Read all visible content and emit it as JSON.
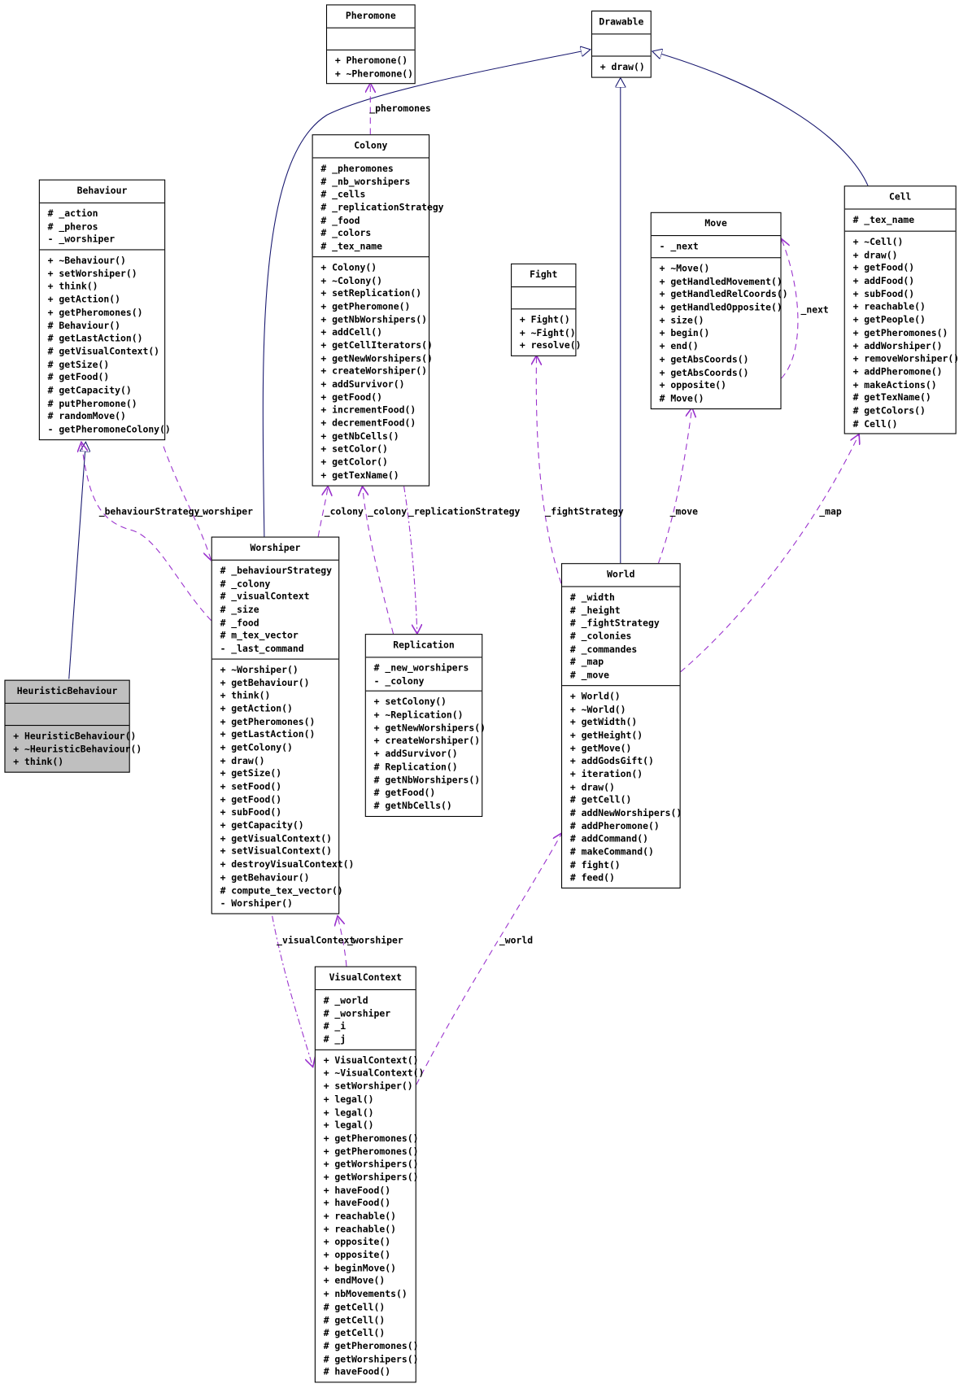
{
  "colors": {
    "inheritance": "#191970",
    "association": "#9a32cd",
    "box_border": "#000000",
    "highlight_box": "#bfbfbf"
  },
  "classes": {
    "pheromone": {
      "name": "Pheromone",
      "attributes": [],
      "operations": [
        "+ Pheromone()",
        "+ ~Pheromone()"
      ]
    },
    "drawable": {
      "name": "Drawable",
      "attributes": [],
      "operations": [
        "+ draw()"
      ]
    },
    "behaviour": {
      "name": "Behaviour",
      "attributes": [
        "# _action",
        "# _pheros",
        "- _worshiper"
      ],
      "operations": [
        "+ ~Behaviour()",
        "+ setWorshiper()",
        "+ think()",
        "+ getAction()",
        "+ getPheromones()",
        "# Behaviour()",
        "# getLastAction()",
        "# getVisualContext()",
        "# getSize()",
        "# getFood()",
        "# getCapacity()",
        "# putPheromone()",
        "# randomMove()",
        "- getPheromoneColony()"
      ]
    },
    "colony": {
      "name": "Colony",
      "attributes": [
        "# _pheromones",
        "# _nb_worshipers",
        "# _cells",
        "# _replicationStrategy",
        "# _food",
        "# _colors",
        "# _tex_name"
      ],
      "operations": [
        "+ Colony()",
        "+ ~Colony()",
        "+ setReplication()",
        "+ getPheromone()",
        "+ getNbWorshipers()",
        "+ addCell()",
        "+ getCellIterators()",
        "+ getNewWorshipers()",
        "+ createWorshiper()",
        "+ addSurvivor()",
        "+ getFood()",
        "+ incrementFood()",
        "+ decrementFood()",
        "+ getNbCells()",
        "+ setColor()",
        "+ getColor()",
        "+ getTexName()"
      ]
    },
    "fight": {
      "name": "Fight",
      "attributes": [],
      "operations": [
        "+ Fight()",
        "+ ~Fight()",
        "+ resolve()"
      ]
    },
    "move": {
      "name": "Move",
      "attributes": [
        "- _next"
      ],
      "operations": [
        "+ ~Move()",
        "+ getHandledMovement()",
        "+ getHandledRelCoords()",
        "+ getHandledOpposite()",
        "+ size()",
        "+ begin()",
        "+ end()",
        "+ getAbsCoords()",
        "+ getAbsCoords()",
        "+ opposite()",
        "# Move()"
      ]
    },
    "cell": {
      "name": "Cell",
      "attributes": [
        "# _tex_name"
      ],
      "operations": [
        "+ ~Cell()",
        "+ draw()",
        "+ getFood()",
        "+ addFood()",
        "+ subFood()",
        "+ reachable()",
        "+ getPeople()",
        "+ getPheromones()",
        "+ addWorshiper()",
        "+ removeWorshiper()",
        "+ addPheromone()",
        "+ makeActions()",
        "# getTexName()",
        "# getColors()",
        "# Cell()"
      ]
    },
    "heuristic_behaviour": {
      "name": "HeuristicBehaviour",
      "attributes": [],
      "operations": [
        "+ HeuristicBehaviour()",
        "+ ~HeuristicBehaviour()",
        "+ think()"
      ]
    },
    "worshiper": {
      "name": "Worshiper",
      "attributes": [
        "# _behaviourStrategy",
        "# _colony",
        "# _visualContext",
        "# _size",
        "# _food",
        "# m_tex_vector",
        "- _last_command"
      ],
      "operations": [
        "+ ~Worshiper()",
        "+ getBehaviour()",
        "+ think()",
        "+ getAction()",
        "+ getPheromones()",
        "+ getLastAction()",
        "+ getColony()",
        "+ draw()",
        "+ getSize()",
        "+ setFood()",
        "+ getFood()",
        "+ subFood()",
        "+ getCapacity()",
        "+ getVisualContext()",
        "+ setVisualContext()",
        "+ destroyVisualContext()",
        "+ getBehaviour()",
        "# compute_tex_vector()",
        "- Worshiper()"
      ]
    },
    "replication": {
      "name": "Replication",
      "attributes": [
        "# _new_worshipers",
        "- _colony"
      ],
      "operations": [
        "+ setColony()",
        "+ ~Replication()",
        "+ getNewWorshipers()",
        "+ createWorshiper()",
        "+ addSurvivor()",
        "# Replication()",
        "# getNbWorshipers()",
        "# getFood()",
        "# getNbCells()"
      ]
    },
    "world": {
      "name": "World",
      "attributes": [
        "# _width",
        "# _height",
        "# _fightStrategy",
        "# _colonies",
        "# _commandes",
        "# _map",
        "# _move"
      ],
      "operations": [
        "+ World()",
        "+ ~World()",
        "+ getWidth()",
        "+ getHeight()",
        "+ getMove()",
        "+ addGodsGift()",
        "+ iteration()",
        "+ draw()",
        "# getCell()",
        "# addNewWorshipers()",
        "# addPheromone()",
        "# addCommand()",
        "# makeCommand()",
        "# fight()",
        "# feed()"
      ]
    },
    "visual_context": {
      "name": "VisualContext",
      "attributes": [
        "# _world",
        "# _worshiper",
        "# _i",
        "# _j"
      ],
      "operations": [
        "+ VisualContext()",
        "+ ~VisualContext()",
        "+ setWorshiper()",
        "+ legal()",
        "+ legal()",
        "+ legal()",
        "+ getPheromones()",
        "+ getPheromones()",
        "+ getWorshipers()",
        "+ getWorshipers()",
        "+ haveFood()",
        "+ haveFood()",
        "+ reachable()",
        "+ reachable()",
        "+ opposite()",
        "+ opposite()",
        "+ beginMove()",
        "+ endMove()",
        "+ nbMovements()",
        "# getCell()",
        "# getCell()",
        "# getCell()",
        "# getPheromones()",
        "# getWorshipers()",
        "# haveFood()"
      ]
    }
  },
  "edge_labels": {
    "pheromones": "_pheromones",
    "behaviour_strategy": "_behaviourStrategy",
    "worshiper_behaviour": "_worshiper",
    "colony_worshiper": "_colony",
    "colony_replication": "_colony",
    "replication_strategy": "_replicationStrategy",
    "fight_strategy": "_fightStrategy",
    "move": "_move",
    "map": "_map",
    "next": "_next",
    "visual_context": "_visualContext",
    "worshiper_vc": "_worshiper",
    "world": "_world"
  }
}
